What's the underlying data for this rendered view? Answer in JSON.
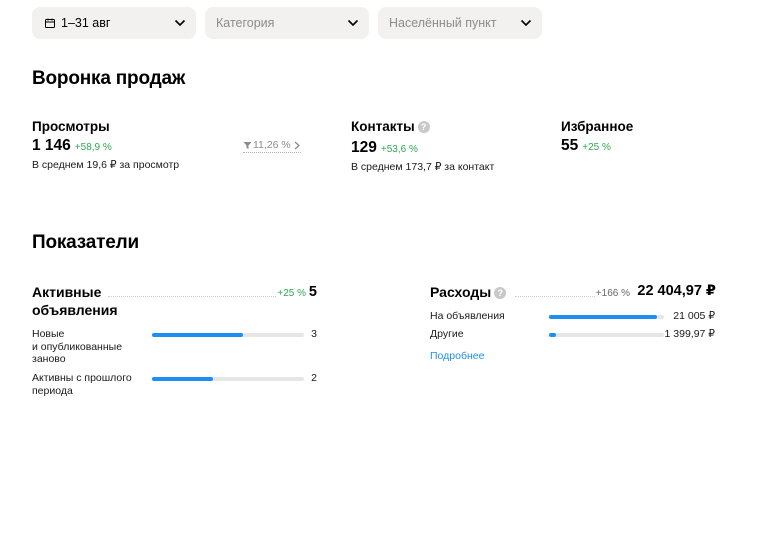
{
  "filters": {
    "date_value": "1–31 авг",
    "category_placeholder": "Категория",
    "location_placeholder": "Населённый пункт"
  },
  "funnel": {
    "title": "Воронка продаж",
    "views": {
      "label": "Просмотры",
      "value": "1 146",
      "delta": "+58,9 %",
      "note": "В среднем 19,6 ₽ за просмотр"
    },
    "conversion": "11,26 %",
    "contacts": {
      "label": "Контакты",
      "value": "129",
      "delta": "+53,6 %",
      "note": "В среднем 173,7 ₽ за контакт"
    },
    "favorites": {
      "label": "Избранное",
      "value": "55",
      "delta": "+25 %"
    }
  },
  "metrics": {
    "title": "Показатели",
    "active": {
      "label_line1": "Активные",
      "label_line2": "объявления",
      "delta": "+25 %",
      "value": "5",
      "rows": [
        {
          "label_lines": [
            "Новые",
            "и опубликованные",
            "заново"
          ],
          "value": "3",
          "fill": 0.6
        },
        {
          "label_lines": [
            "Активны с прошлого",
            "периода"
          ],
          "value": "2",
          "fill": 0.4
        }
      ]
    },
    "expenses": {
      "label": "Расходы",
      "delta": "+166 %",
      "value": "22 404,97 ₽",
      "rows": [
        {
          "label": "На объявления",
          "value": "21 005 ₽",
          "fill": 0.94
        },
        {
          "label": "Другие",
          "value": "1 399,97 ₽",
          "fill": 0.06
        }
      ],
      "more_link": "Подробнее"
    }
  },
  "colors": {
    "accent_blue": "#1d8ff0",
    "positive_green": "#2ea84f",
    "muted_gray": "#8c8c8c",
    "filter_bg": "#f2f1f0"
  },
  "icons": {
    "calendar": "calendar-icon",
    "chevron": "chevron-down-icon",
    "help": "help-icon",
    "funnel": "funnel-icon"
  }
}
